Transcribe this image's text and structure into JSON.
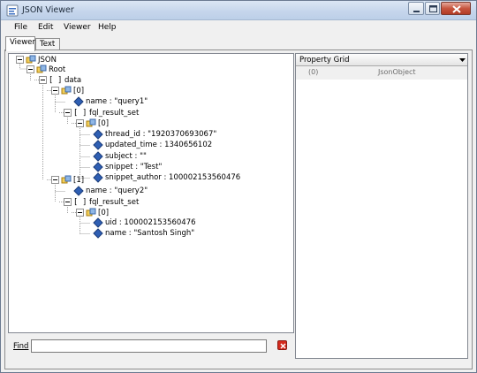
{
  "window": {
    "title": "JSON Viewer"
  },
  "menu": {
    "items": [
      "File",
      "Edit",
      "Viewer",
      "Help"
    ]
  },
  "tabs": [
    "Viewer",
    "Text"
  ],
  "tree": {
    "root": "JSON",
    "nodes": [
      {
        "label": "Root",
        "icon": "object-icon"
      },
      {
        "label": "data",
        "icon": "array-icon"
      },
      {
        "label": "[0]",
        "icon": "object-icon"
      },
      {
        "label": "name : \"query1\"",
        "icon": "value-icon"
      },
      {
        "label": "fql_result_set",
        "icon": "array-icon"
      },
      {
        "label": "[0]",
        "icon": "object-icon"
      },
      {
        "label": "thread_id : \"1920370693067\"",
        "icon": "value-icon"
      },
      {
        "label": "updated_time : 1340656102",
        "icon": "value-icon"
      },
      {
        "label": "subject : \"\"",
        "icon": "value-icon"
      },
      {
        "label": "snippet : \"Test\"",
        "icon": "value-icon"
      },
      {
        "label": "snippet_author : 100002153560476",
        "icon": "value-icon"
      },
      {
        "label": "[1]",
        "icon": "object-icon"
      },
      {
        "label": "name : \"query2\"",
        "icon": "value-icon"
      },
      {
        "label": "fql_result_set",
        "icon": "array-icon"
      },
      {
        "label": "[0]",
        "icon": "object-icon"
      },
      {
        "label": "uid : 100002153560476",
        "icon": "value-icon"
      },
      {
        "label": "name : \"Santosh Singh\"",
        "icon": "value-icon"
      }
    ]
  },
  "find": {
    "label": "Find",
    "value": ""
  },
  "property_grid": {
    "title": "Property Grid",
    "rows": [
      {
        "key": "(0)",
        "value": "JsonObject"
      }
    ]
  },
  "colors": {
    "value_icon": "#2f5fb3",
    "object_icon": "#d6a21c",
    "array_bracket": "#000000"
  }
}
